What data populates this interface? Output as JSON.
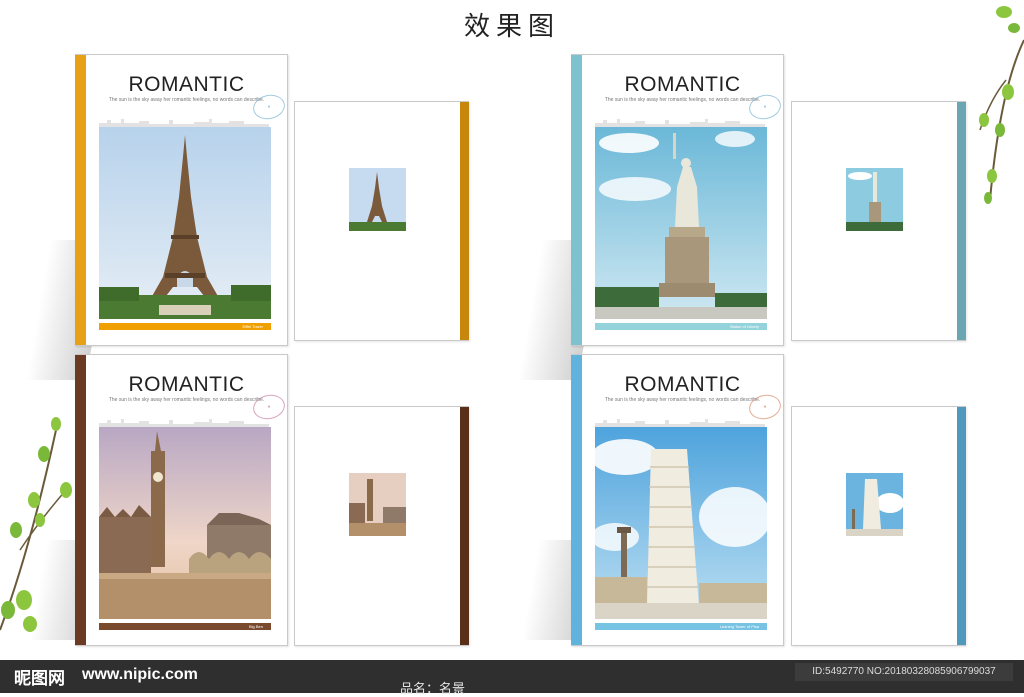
{
  "page_title": "效果图",
  "covers": [
    {
      "heading": "ROMANTIC",
      "tagline": "The sun is the sky away her romantic feelings, no words can describe.",
      "caption": "Eiffel Tower",
      "stamp": "",
      "accent": "#f0a000",
      "spine": "#e6a117",
      "subject": "eiffel-tower"
    },
    {
      "heading": "ROMANTIC",
      "tagline": "The sun is the sky away her romantic feelings, no words can describe.",
      "caption": "Statue of Liberty",
      "stamp": "",
      "accent": "#94d3dc",
      "spine": "#7fc2cf",
      "subject": "statue-of-liberty"
    },
    {
      "heading": "ROMANTIC",
      "tagline": "The sun is the sky away her romantic feelings, no words can describe.",
      "caption": "Big Ben",
      "stamp": "",
      "accent": "#7a4a2e",
      "spine": "#6b3a22",
      "subject": "big-ben"
    },
    {
      "heading": "ROMANTIC",
      "tagline": "The sun is the sky away her romantic feelings, no words can describe.",
      "caption": "Leaning Tower of Pisa",
      "stamp": "",
      "accent": "#77c3e4",
      "spine": "#5fb3dc",
      "subject": "leaning-tower-of-pisa"
    }
  ],
  "footer": {
    "logo": "昵图网",
    "site": "www.nipic.com",
    "id_text": "ID:5492770 NO:20180328085906799037",
    "product_name": "品名：名景"
  }
}
